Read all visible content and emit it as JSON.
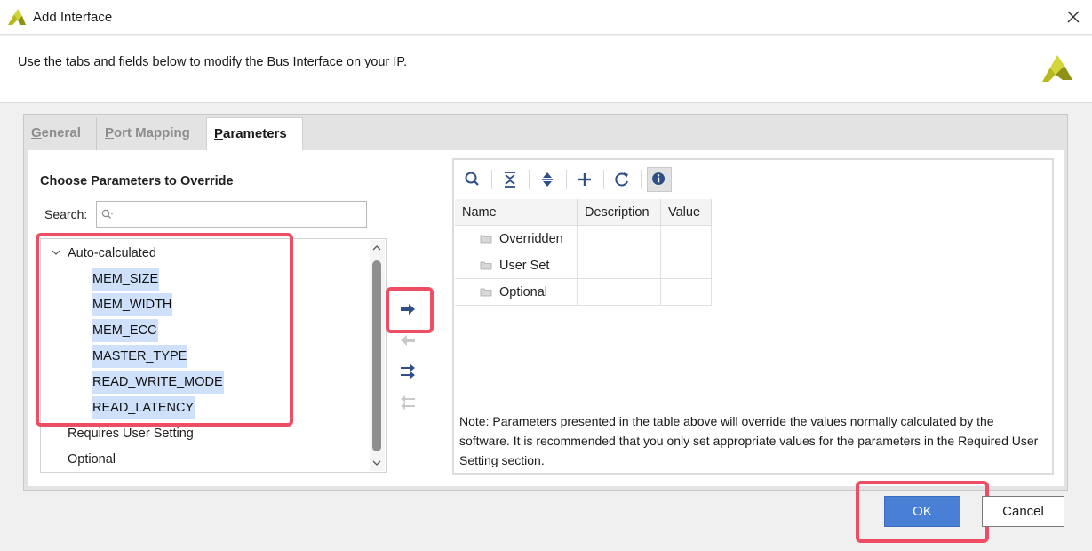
{
  "window": {
    "title": "Add Interface",
    "close_icon": "close-icon"
  },
  "header": {
    "description": "Use the tabs and fields below to modify the Bus Interface on your IP."
  },
  "tabs": [
    {
      "label": "General",
      "underline": "G",
      "rest": "eneral"
    },
    {
      "label": "Port Mapping",
      "underline": "P",
      "rest": "ort Mapping"
    },
    {
      "label": "Parameters",
      "underline": "P",
      "rest": "arameters"
    }
  ],
  "left": {
    "title": "Choose Parameters to Override",
    "search_label": "Search:",
    "search_underline": "S",
    "search_rest": "earch:",
    "search_value": "",
    "tree": {
      "group_label": "Auto-calculated",
      "items": [
        "MEM_SIZE",
        "MEM_WIDTH",
        "MEM_ECC",
        "MASTER_TYPE",
        "READ_WRITE_MODE",
        "READ_LATENCY"
      ],
      "other_groups": [
        "Requires User Setting",
        "Optional"
      ]
    }
  },
  "right": {
    "toolbar_icons": [
      "search-icon",
      "collapse-all-icon",
      "expand-all-icon",
      "add-icon",
      "refresh-icon",
      "info-icon"
    ],
    "columns": [
      "Name",
      "Description",
      "Value"
    ],
    "rows": [
      {
        "name": "Overridden",
        "description": "",
        "value": ""
      },
      {
        "name": "User Set",
        "description": "",
        "value": ""
      },
      {
        "name": "Optional",
        "description": "",
        "value": ""
      }
    ],
    "note": "Note: Parameters presented in the table above will override the values normally calculated by the software. It is recommended that you only set appropriate values for the parameters in the Required User Setting section."
  },
  "footer": {
    "ok_label": "OK",
    "cancel_label": "Cancel"
  },
  "colors": {
    "accent": "#4a7fd6",
    "highlight": "#ee4d63",
    "selection": "#cfe0fb"
  }
}
